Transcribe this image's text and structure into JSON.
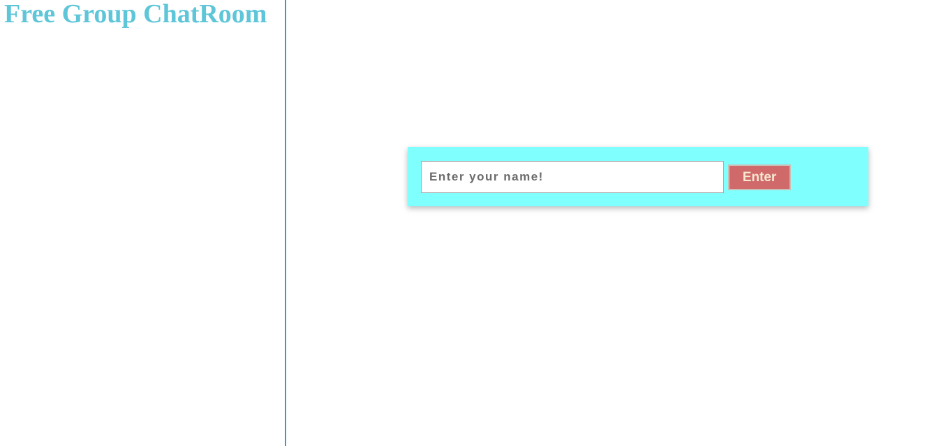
{
  "sidebar": {
    "title": "Free Group ChatRoom"
  },
  "login": {
    "name_placeholder": "Enter your name!",
    "name_value": "",
    "enter_label": "Enter"
  },
  "colors": {
    "title": "#5ec6d8",
    "divider": "#3f97c9",
    "panel_background": "#80ffff",
    "button_background": "#d06a6a",
    "button_text": "#f6e7d2"
  }
}
